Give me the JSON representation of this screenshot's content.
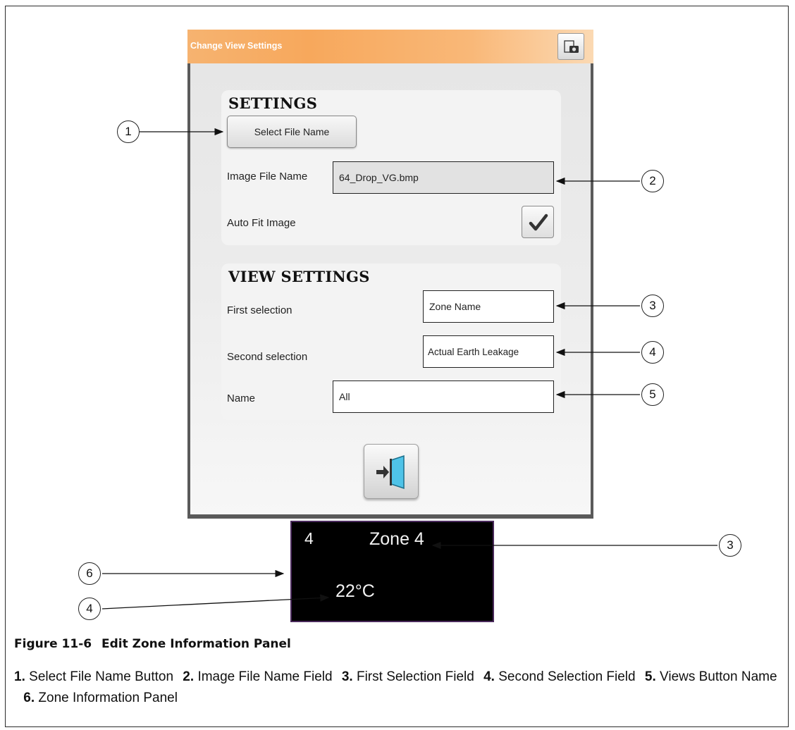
{
  "dialog": {
    "title": "Change View Settings",
    "settings": {
      "heading": "SETTINGS",
      "select_button_label": "Select File Name",
      "image_file_label": "Image File Name",
      "image_file_value": "64_Drop_VG.bmp",
      "auto_fit_label": "Auto Fit Image",
      "auto_fit_checked": true
    },
    "view_settings": {
      "heading": "VIEW SETTINGS",
      "first_label": "First selection",
      "first_value": "Zone Name",
      "second_label": "Second selection",
      "second_value": "Actual Earth Leakage",
      "name_label": "Name",
      "name_value": "All"
    },
    "icons": {
      "camera": "camera-icon",
      "exit": "exit-door-icon",
      "check": "checkmark-icon"
    }
  },
  "zone_panel": {
    "number": "4",
    "name": "Zone 4",
    "temperature": "22°C"
  },
  "callouts": [
    "1",
    "2",
    "3",
    "4",
    "5",
    "3",
    "6",
    "4"
  ],
  "figure": {
    "number": "Figure 11-6",
    "title": "Edit Zone Information Panel"
  },
  "legend": [
    {
      "num": "1.",
      "text": "Select File Name Button"
    },
    {
      "num": "2.",
      "text": "Image File Name Field"
    },
    {
      "num": "3.",
      "text": "First Selection Field"
    },
    {
      "num": "4.",
      "text": "Second Selection Field"
    },
    {
      "num": "5.",
      "text": "Views Button Name"
    },
    {
      "num": "6.",
      "text": "Zone Information Panel"
    }
  ],
  "colors": {
    "title_bar": "#f7a85c",
    "dialog_border": "#5a5a5a",
    "zone_panel_bg": "#000000",
    "zone_panel_border": "#4a2a5c"
  }
}
